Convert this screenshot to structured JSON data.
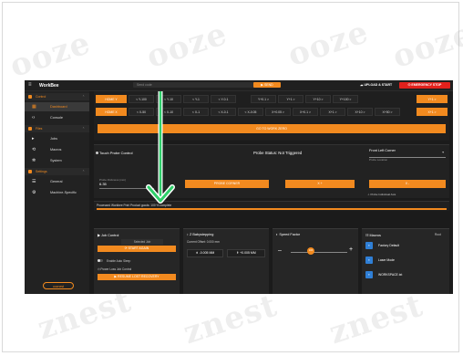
{
  "watermark": "ooze",
  "watermark2": "znest",
  "header": {
    "brand": "WorkBee",
    "search_placeholder": "Send code",
    "send_label": "▶ SEND",
    "upload_label": "UPLOAD & START",
    "estop_label": "EMERGENCY STOP"
  },
  "sidebar": {
    "control": "Control",
    "dashboard": "Dashboard",
    "console": "Console",
    "files": "Files",
    "jobs": "Jobs",
    "macros": "Macros",
    "system": "System",
    "settings": "Settings",
    "general": "General",
    "machine_specific": "Machine-Specific",
    "logo": "ooznest"
  },
  "jog": {
    "row_y": [
      "HOME Y",
      "< Y-100",
      "< Y-10",
      "< Y-1",
      "< Y-0.1",
      "Y+0.1 >",
      "Y+1 >",
      "Y+10 >",
      "Y+100 >",
      "Y+1 >"
    ],
    "row_x": [
      "HOME X",
      "< X-50",
      "< X-10",
      "< X-1",
      "< X-0.1",
      "< X-0.05",
      "X+0.05 >",
      "X+0.1 >",
      "X+1 >",
      "X+10 >",
      "X+50 >",
      "X+1 >"
    ],
    "home_all": "GO TO WORK ZERO"
  },
  "probe": {
    "title": "Touch Probe Control",
    "status": "Probe Status: Not Triggered",
    "corner": "Front Left Corner",
    "corner_label": "Probe Location",
    "thickness_label": "Probe thickness (mm)",
    "thickness_value": "6.35",
    "probe_button": "PROBE CORNER",
    "btn_b": "X +",
    "btn_c": "X -",
    "help": "Probe Individual Axis"
  },
  "progress": {
    "text": "Processed Workbee Print Product goods: 100 % complete",
    "fraction": 1.0
  },
  "job_control": {
    "title": "Job Control",
    "field": "Selected Job",
    "start_label": "START AGAIN",
    "auto_sleep": "Enable Auto Sleep",
    "power_loss": "Power Loss Job Control",
    "resume_label": "RESUME LOST RECOVERY"
  },
  "babystep": {
    "title": "Z Babystepping",
    "offset": "Current Offset: 0.000 mm",
    "minus": "-0.005 MM",
    "plus": "+0.005 MM"
  },
  "speed": {
    "title": "Speed Factor",
    "minus": "–",
    "plus": "+",
    "value": "100"
  },
  "macros": {
    "title": "Macros",
    "root": "Root",
    "items": [
      "Factory Default",
      "Laser Mode",
      "WORKSPACE.txt"
    ]
  }
}
